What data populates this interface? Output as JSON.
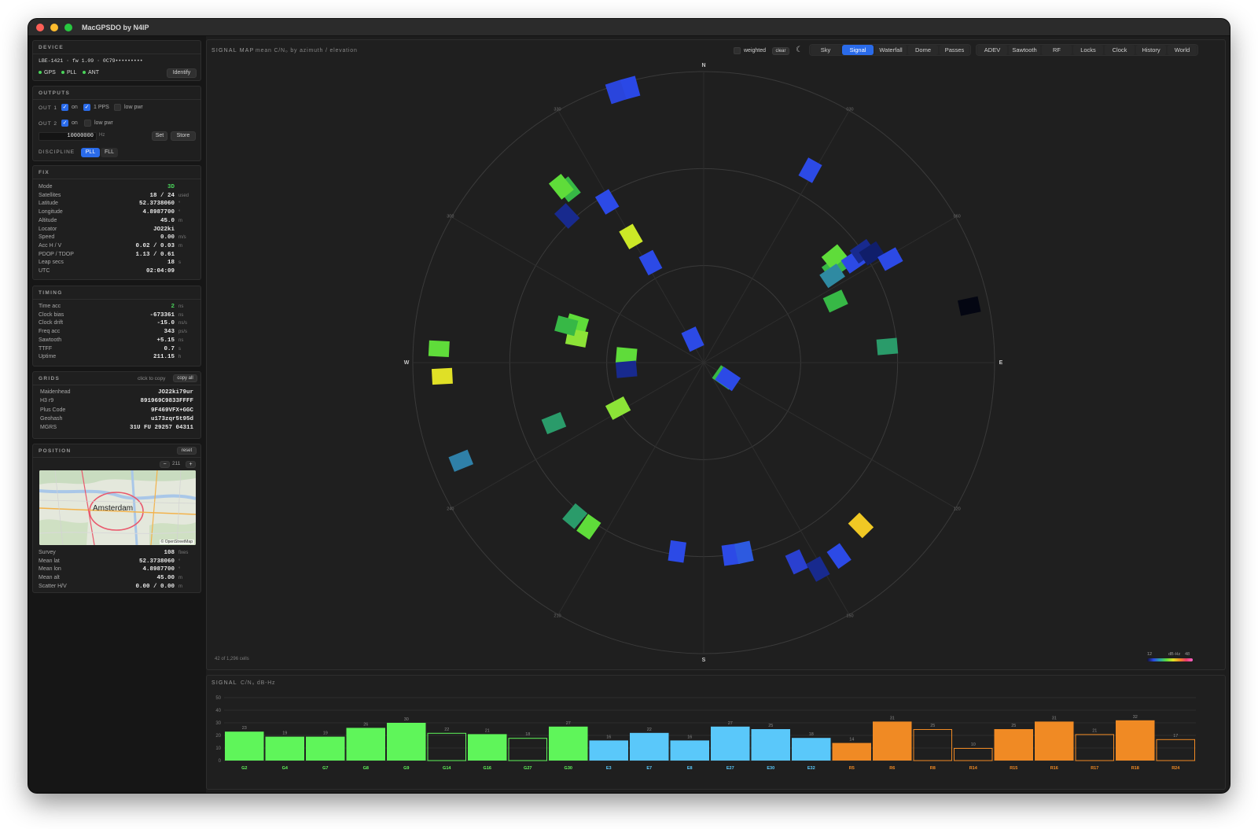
{
  "window": {
    "title": "MacGPSDO by N4IP"
  },
  "device": {
    "title": "DEVICE",
    "info": "LBE-1421 · fw 1.09 · 0C79•••••••••",
    "status": [
      "GPS",
      "PLL",
      "ANT"
    ],
    "identify_label": "Identify"
  },
  "outputs": {
    "title": "OUTPUTS",
    "out1_label": "OUT 1",
    "out1_on": "on",
    "out1_pps": "1 PPS",
    "out1_lowpwr": "low pwr",
    "out2_label": "OUT 2",
    "out2_on": "on",
    "out2_lowpwr": "low pwr",
    "frequency": "10000000",
    "freq_unit": "Hz",
    "set_label": "Set",
    "store_label": "Store",
    "discipline_label": "DISCIPLINE",
    "discipline_options": [
      "PLL",
      "FLL"
    ]
  },
  "fix": {
    "title": "FIX",
    "rows": [
      {
        "label": "Mode",
        "value": "3D",
        "unit": ""
      },
      {
        "label": "Satellites",
        "value": "18 / 24",
        "unit": "used"
      },
      {
        "label": "Latitude",
        "value": "52.3738060",
        "unit": "°"
      },
      {
        "label": "Longitude",
        "value": "4.8987700",
        "unit": "°"
      },
      {
        "label": "Altitude",
        "value": "45.0",
        "unit": "m"
      },
      {
        "label": "Locator",
        "value": "JO22ki",
        "unit": ""
      },
      {
        "label": "Speed",
        "value": "0.00",
        "unit": "m/s"
      },
      {
        "label": "Acc H / V",
        "value": "0.02 / 0.03",
        "unit": "m"
      },
      {
        "label": "PDOP / TDOP",
        "value": "1.13 / 0.61",
        "unit": ""
      },
      {
        "label": "Leap secs",
        "value": "18",
        "unit": "s"
      },
      {
        "label": "UTC",
        "value": "02:04:09",
        "unit": ""
      }
    ]
  },
  "timing": {
    "title": "TIMING",
    "rows": [
      {
        "label": "Time acc",
        "value": "2",
        "unit": "ns"
      },
      {
        "label": "Clock bias",
        "value": "-673361",
        "unit": "ns"
      },
      {
        "label": "Clock drift",
        "value": "-15.0",
        "unit": "ns/s"
      },
      {
        "label": "Freq acc",
        "value": "343",
        "unit": "ps/s"
      },
      {
        "label": "Sawtooth",
        "value": "+5.15",
        "unit": "ns"
      },
      {
        "label": "TTFF",
        "value": "0.7",
        "unit": "s"
      },
      {
        "label": "Uptime",
        "value": "211.15",
        "unit": "h"
      }
    ]
  },
  "grids": {
    "title": "GRIDS",
    "hint": "click to copy",
    "copy_all_label": "copy all",
    "rows": [
      {
        "label": "Maidenhead",
        "value": "JO22ki79ur"
      },
      {
        "label": "H3 r9",
        "value": "891969C9833FFFF"
      },
      {
        "label": "Plus Code",
        "value": "9F469VFX+GGC"
      },
      {
        "label": "Geohash",
        "value": "u173zqr5t95d"
      },
      {
        "label": "MGRS",
        "value": "31U FU 29257 04311"
      }
    ]
  },
  "position": {
    "title": "POSITION",
    "reset_label": "reset",
    "zoom_minus": "−",
    "zoom_value": "211",
    "zoom_plus": "+",
    "map_city": "Amsterdam",
    "map_credit": "© OpenStreetMap",
    "rows": [
      {
        "label": "Survey",
        "value": "108",
        "unit": "fixes"
      },
      {
        "label": "Mean lat",
        "value": "52.3738060",
        "unit": "°"
      },
      {
        "label": "Mean lon",
        "value": "4.8987700",
        "unit": "°"
      },
      {
        "label": "Mean alt",
        "value": "45.00",
        "unit": "m"
      },
      {
        "label": "Scatter H/V",
        "value": "0.00 / 0.00",
        "unit": "m"
      }
    ]
  },
  "signal_map": {
    "title": "SIGNAL MAP",
    "subtitle": "mean C/N₀ by azimuth / elevation",
    "weighted_label": "weighted",
    "clear_label": "clear",
    "moon_icon": "moon-icon",
    "cells_label": "42 of 1,296 cells",
    "legend_min": "12",
    "legend_unit": "dB-Hz",
    "legend_max": "48",
    "compass": {
      "N": "N",
      "E": "E",
      "S": "S",
      "W": "W"
    },
    "bearings": [
      "030",
      "060",
      "120",
      "150",
      "210",
      "240",
      "300",
      "330"
    ],
    "cells": [
      {
        "az": 345,
        "el": 2,
        "color": "#2a48e6"
      },
      {
        "az": 342,
        "el": 2,
        "color": "#2a45dc"
      },
      {
        "az": 29,
        "el": 22,
        "color": "#2c4ae6"
      },
      {
        "az": 317,
        "el": 28,
        "color": "#182a8e"
      },
      {
        "az": 322,
        "el": 22,
        "color": "#37b846"
      },
      {
        "az": 321,
        "el": 20,
        "color": "#5fdc3a"
      },
      {
        "az": 329,
        "el": 32,
        "color": "#2c4ae6"
      },
      {
        "az": 330,
        "el": 45,
        "color": "#cce827"
      },
      {
        "az": 332,
        "el": 55,
        "color": "#2c4ae6"
      },
      {
        "az": 54,
        "el": 40,
        "color": "#37b846"
      },
      {
        "az": 51,
        "el": 38,
        "color": "#5fdc3a"
      },
      {
        "az": 56,
        "el": 42,
        "color": "#2f8aa2"
      },
      {
        "az": 56,
        "el": 34,
        "color": "#2c4ae6"
      },
      {
        "az": 55,
        "el": 30,
        "color": "#182a8e"
      },
      {
        "az": 57,
        "el": 28,
        "color": "#101e6a"
      },
      {
        "az": 61,
        "el": 24,
        "color": "#2c4ae6"
      },
      {
        "az": 65,
        "el": 45,
        "color": "#37b846"
      },
      {
        "az": 78,
        "el": 6,
        "color": "#040612"
      },
      {
        "az": 85,
        "el": 33,
        "color": "#2a9b6a"
      },
      {
        "az": 335,
        "el": 82,
        "color": "#2c4ae6"
      },
      {
        "az": 273,
        "el": 8,
        "color": "#5fdc3a"
      },
      {
        "az": 267,
        "el": 9,
        "color": "#e0e026"
      },
      {
        "az": 287,
        "el": 49,
        "color": "#5fdc3a"
      },
      {
        "az": 281,
        "el": 50,
        "color": "#8ce337"
      },
      {
        "az": 285,
        "el": 46,
        "color": "#37b846"
      },
      {
        "az": 275,
        "el": 66,
        "color": "#5fdc3a"
      },
      {
        "az": 265,
        "el": 66,
        "color": "#182a8e"
      },
      {
        "az": 248,
        "el": 40,
        "color": "#2a9b6a"
      },
      {
        "az": 242,
        "el": 60,
        "color": "#8ce337"
      },
      {
        "az": 248,
        "el": 9,
        "color": "#2f80a8"
      },
      {
        "az": 125,
        "el": 82,
        "color": "#37b846"
      },
      {
        "az": 124,
        "el": 81,
        "color": "#2c4ae6"
      },
      {
        "az": 220,
        "el": 28,
        "color": "#2a9b6a"
      },
      {
        "az": 215,
        "el": 28,
        "color": "#5fdc3a"
      },
      {
        "az": 188,
        "el": 31,
        "color": "#2c4ae6"
      },
      {
        "az": 172,
        "el": 30,
        "color": "#2c4ae6"
      },
      {
        "az": 168,
        "el": 30,
        "color": "#2d5ae0"
      },
      {
        "az": 136,
        "el": 20,
        "color": "#f0c824"
      },
      {
        "az": 145,
        "el": 17,
        "color": "#2c4ae6"
      },
      {
        "az": 151,
        "el": 17,
        "color": "#182a8e"
      },
      {
        "az": 155,
        "el": 22,
        "color": "#2a40d0"
      }
    ]
  },
  "signal": {
    "title": "SIGNAL",
    "subtitle": "C/N₀ dB-Hz",
    "chart_data": {
      "type": "bar",
      "ylim": [
        0,
        50
      ],
      "yticks": [
        0,
        10,
        20,
        30,
        40,
        50
      ],
      "bars": [
        {
          "label": "G2",
          "value": 23,
          "used": true,
          "color": "#5ff55a"
        },
        {
          "label": "G4",
          "value": 19,
          "used": true,
          "color": "#5ff55a"
        },
        {
          "label": "G7",
          "value": 19,
          "used": true,
          "color": "#5ff55a"
        },
        {
          "label": "G8",
          "value": 26,
          "used": true,
          "color": "#5ff55a"
        },
        {
          "label": "G9",
          "value": 30,
          "used": true,
          "color": "#5ff55a"
        },
        {
          "label": "G14",
          "value": 22,
          "used": false,
          "color": "#5ff55a"
        },
        {
          "label": "G16",
          "value": 21,
          "used": true,
          "color": "#5ff55a"
        },
        {
          "label": "G27",
          "value": 18,
          "used": false,
          "color": "#5ff55a"
        },
        {
          "label": "G30",
          "value": 27,
          "used": true,
          "color": "#5ff55a"
        },
        {
          "label": "E3",
          "value": 16,
          "used": true,
          "color": "#5ac8fa"
        },
        {
          "label": "E7",
          "value": 22,
          "used": true,
          "color": "#5ac8fa"
        },
        {
          "label": "E8",
          "value": 16,
          "used": true,
          "color": "#5ac8fa"
        },
        {
          "label": "E27",
          "value": 27,
          "used": true,
          "color": "#5ac8fa"
        },
        {
          "label": "E30",
          "value": 25,
          "used": true,
          "color": "#5ac8fa"
        },
        {
          "label": "E32",
          "value": 18,
          "used": true,
          "color": "#5ac8fa"
        },
        {
          "label": "R5",
          "value": 14,
          "used": true,
          "color": "#f08a24"
        },
        {
          "label": "R6",
          "value": 31,
          "used": true,
          "color": "#f08a24"
        },
        {
          "label": "R8",
          "value": 25,
          "used": false,
          "color": "#f08a24"
        },
        {
          "label": "R14",
          "value": 10,
          "used": false,
          "color": "#f08a24"
        },
        {
          "label": "R15",
          "value": 25,
          "used": true,
          "color": "#f08a24"
        },
        {
          "label": "R16",
          "value": 31,
          "used": true,
          "color": "#f08a24"
        },
        {
          "label": "R17",
          "value": 21,
          "used": false,
          "color": "#f08a24"
        },
        {
          "label": "R18",
          "value": 32,
          "used": true,
          "color": "#f08a24"
        },
        {
          "label": "R24",
          "value": 17,
          "used": false,
          "color": "#f08a24"
        }
      ]
    }
  },
  "tabs": {
    "view": [
      "Sky",
      "Signal",
      "Waterfall",
      "Dome",
      "Passes"
    ],
    "analysis": [
      "ADEV",
      "Sawtooth",
      "RF",
      "Locks",
      "Clock",
      "History",
      "World"
    ],
    "active": "Signal"
  },
  "colors": {
    "accent": "#2a6bea",
    "ok_green": "#4ad35a"
  }
}
